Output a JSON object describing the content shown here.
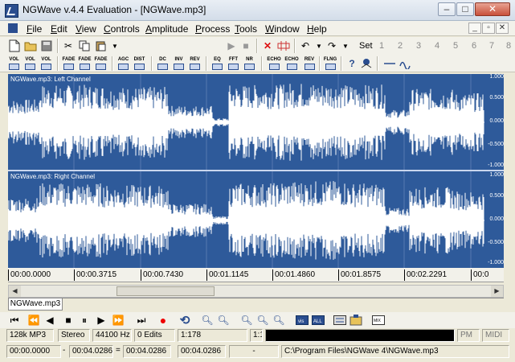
{
  "window": {
    "title": "NGWave v.4.4 Evaluation - [NGWave.mp3]"
  },
  "menu": {
    "items": [
      "File",
      "Edit",
      "View",
      "Controls",
      "Amplitude",
      "Process",
      "Tools",
      "Window",
      "Help"
    ]
  },
  "toolbar": {
    "set_label": "Set",
    "set_numbers": [
      "1",
      "2",
      "3",
      "4",
      "5",
      "6",
      "7",
      "8"
    ],
    "effects": [
      "VOL",
      "VOL",
      "VOL",
      "FADE",
      "FADE",
      "FADE",
      "AGC",
      "DIST",
      "DC",
      "INV",
      "REV",
      "EQ",
      "FFT",
      "NR",
      "ECHO",
      "ECHO",
      "REV",
      "FLNG"
    ]
  },
  "channels": {
    "left_label": "NGWave.mp3: Left Channel",
    "right_label": "NGWave.mp3: Right Channel",
    "scale": [
      "1.000",
      "0.500",
      "0.000",
      "-0.500",
      "-1.000"
    ]
  },
  "timeline": {
    "ticks": [
      "00:00.0000",
      "00:00.3715",
      "00:00.7430",
      "00:01.1145",
      "00:01.4860",
      "00:01.8575",
      "00:02.2291",
      "00:0"
    ]
  },
  "tab": {
    "label": "NGWave.mp3"
  },
  "status": {
    "format": "128k MP3",
    "channels": "Stereo",
    "rate": "44100 Hz",
    "edits": "0 Edits",
    "zoom": "1:178",
    "ratio": "1:1",
    "pm": "PM",
    "midi": "MIDI",
    "sel_start": "00:00.0000",
    "sel_dash": "-",
    "sel_end": "00:04.0286",
    "equals": "=",
    "sel_len": "00:04.0286",
    "total": "00:04.0286",
    "cursor": "-",
    "path": "C:\\Program Files\\NGWave 4\\NGWave.mp3"
  }
}
